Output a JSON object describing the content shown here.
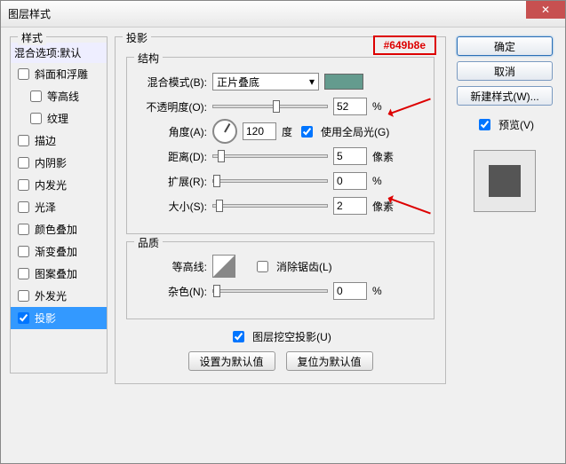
{
  "window": {
    "title": "图层样式"
  },
  "hex_callout": "#649b8e",
  "styles": {
    "header": "样式",
    "default_item": "混合选项:默认",
    "items": [
      {
        "label": "斜面和浮雕",
        "checked": false
      },
      {
        "label": "等高线",
        "checked": false,
        "sub": true
      },
      {
        "label": "纹理",
        "checked": false,
        "sub": true
      },
      {
        "label": "描边",
        "checked": false
      },
      {
        "label": "内阴影",
        "checked": false
      },
      {
        "label": "内发光",
        "checked": false
      },
      {
        "label": "光泽",
        "checked": false
      },
      {
        "label": "颜色叠加",
        "checked": false
      },
      {
        "label": "渐变叠加",
        "checked": false
      },
      {
        "label": "图案叠加",
        "checked": false
      },
      {
        "label": "外发光",
        "checked": false
      },
      {
        "label": "投影",
        "checked": true,
        "selected": true
      }
    ]
  },
  "main": {
    "title": "投影",
    "structure": {
      "legend": "结构",
      "blend_mode_label": "混合模式(B):",
      "blend_mode_value": "正片叠底",
      "color": "#649b8e",
      "opacity_label": "不透明度(O):",
      "opacity_value": "52",
      "opacity_unit": "%",
      "angle_label": "角度(A):",
      "angle_value": "120",
      "angle_unit": "度",
      "global_light_label": "使用全局光(G)",
      "global_light_checked": true,
      "distance_label": "距离(D):",
      "distance_value": "5",
      "distance_unit": "像素",
      "spread_label": "扩展(R):",
      "spread_value": "0",
      "spread_unit": "%",
      "size_label": "大小(S):",
      "size_value": "2",
      "size_unit": "像素"
    },
    "quality": {
      "legend": "品质",
      "contour_label": "等高线:",
      "antialias_label": "消除锯齿(L)",
      "antialias_checked": false,
      "noise_label": "杂色(N):",
      "noise_value": "0",
      "noise_unit": "%"
    },
    "knockout_label": "图层挖空投影(U)",
    "knockout_checked": true,
    "make_default": "设置为默认值",
    "reset_default": "复位为默认值"
  },
  "buttons": {
    "ok": "确定",
    "cancel": "取消",
    "new_style": "新建样式(W)...",
    "preview_label": "预览(V)",
    "preview_checked": true
  }
}
